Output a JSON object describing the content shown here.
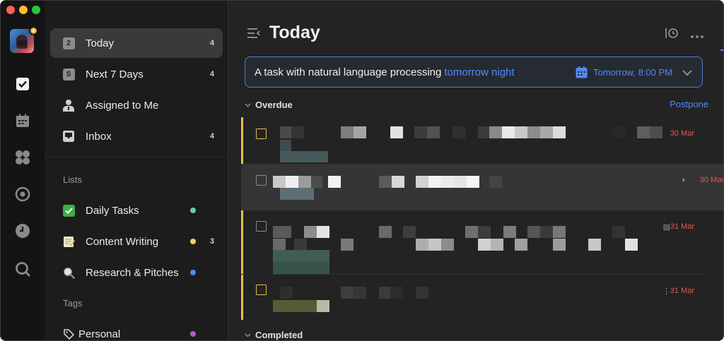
{
  "colors": {
    "accent": "#4f8cf7",
    "overdue": "#e05a4b",
    "priority_medium": "#e6c14a",
    "dot_teal": "#5fd1b8",
    "dot_yellow": "#f2d25c",
    "dot_blue": "#4f8cf7",
    "dot_purple": "#b05bd6"
  },
  "rail": {
    "icons": [
      "task-checkbox-icon",
      "calendar-icon",
      "grid-icon",
      "focus-icon",
      "clock-icon",
      "search-icon"
    ]
  },
  "sidebar": {
    "smart_lists": [
      {
        "label": "Today",
        "count": "4",
        "icon": "today-calendar-icon",
        "icon_text": "2"
      },
      {
        "label": "Next 7 Days",
        "count": "4",
        "icon": "next7-calendar-icon",
        "icon_text": "S"
      },
      {
        "label": "Assigned to Me",
        "count": "",
        "icon": "person-icon"
      },
      {
        "label": "Inbox",
        "count": "4",
        "icon": "inbox-icon"
      }
    ],
    "lists_title": "Lists",
    "lists": [
      {
        "label": "Daily Tasks",
        "count": "",
        "icon": "check-emoji-icon",
        "dot": "teal"
      },
      {
        "label": "Content Writing",
        "count": "3",
        "icon": "memo-emoji-icon",
        "dot": "yellow"
      },
      {
        "label": "Research & Pitches",
        "count": "",
        "icon": "magnifier-emoji-icon",
        "dot": "blue"
      }
    ],
    "tags_title": "Tags",
    "tags": [
      {
        "label": "Personal",
        "icon": "tag-icon",
        "dot": "purple"
      }
    ]
  },
  "main": {
    "title": "Today",
    "add_task": {
      "text": "A task with natural language processing",
      "highlight": "tomorrow night",
      "date_label": "Tomorrow, 8:00 PM"
    },
    "overdue_label": "Overdue",
    "postpone_label": "Postpone",
    "completed_label": "Completed",
    "tasks": [
      {
        "due": "30 Mar",
        "checkbox": "yellow",
        "priority_bar": true
      },
      {
        "due": "30 Mar",
        "checkbox": "grey",
        "priority_bar": false,
        "highlighted": true
      },
      {
        "due": "31 Mar",
        "checkbox": "grey",
        "priority_bar": true
      },
      {
        "due": "31 Mar",
        "checkbox": "yellow",
        "priority_bar": true
      }
    ]
  }
}
